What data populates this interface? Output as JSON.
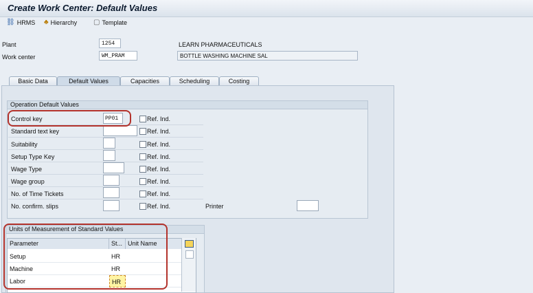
{
  "window": {
    "title": "Create Work Center: Default Values"
  },
  "toolbar": {
    "hrms": "HRMS",
    "hierarchy": "Hierarchy",
    "template": "Template"
  },
  "header": {
    "plant_label": "Plant",
    "plant_value": "1254",
    "plant_desc": "LEARN PHARMACEUTICALS",
    "wc_label": "Work center",
    "wc_value": "WM_PRAM",
    "wc_desc": "BOTTLE WASHING MACHINE SAL"
  },
  "tabs": [
    "Basic Data",
    "Default Values",
    "Capacities",
    "Scheduling",
    "Costing"
  ],
  "op_defaults": {
    "title": "Operation Default Values",
    "ref_label": "Ref. Ind.",
    "rows": [
      {
        "label": "Control key",
        "value": "PP01"
      },
      {
        "label": "Standard text key",
        "value": ""
      },
      {
        "label": "Suitability",
        "value": ""
      },
      {
        "label": "Setup Type Key",
        "value": ""
      },
      {
        "label": "Wage Type",
        "value": ""
      },
      {
        "label": "Wage group",
        "value": ""
      },
      {
        "label": "No. of Time Tickets",
        "value": ""
      },
      {
        "label": "No. confirm. slips",
        "value": ""
      }
    ],
    "printer_label": "Printer",
    "printer_value": ""
  },
  "units": {
    "title": "Units of Measurement of Standard Values",
    "headers": [
      "Parameter",
      "St...",
      "Unit Name"
    ],
    "rows": [
      {
        "param": "Setup",
        "unit": "HR",
        "name": ""
      },
      {
        "param": "Machine",
        "unit": "HR",
        "name": ""
      },
      {
        "param": "Labor",
        "unit": "HR",
        "name": ""
      }
    ]
  },
  "colors": {
    "annotation": "#b3322b",
    "highlight": "#fff4a3"
  }
}
